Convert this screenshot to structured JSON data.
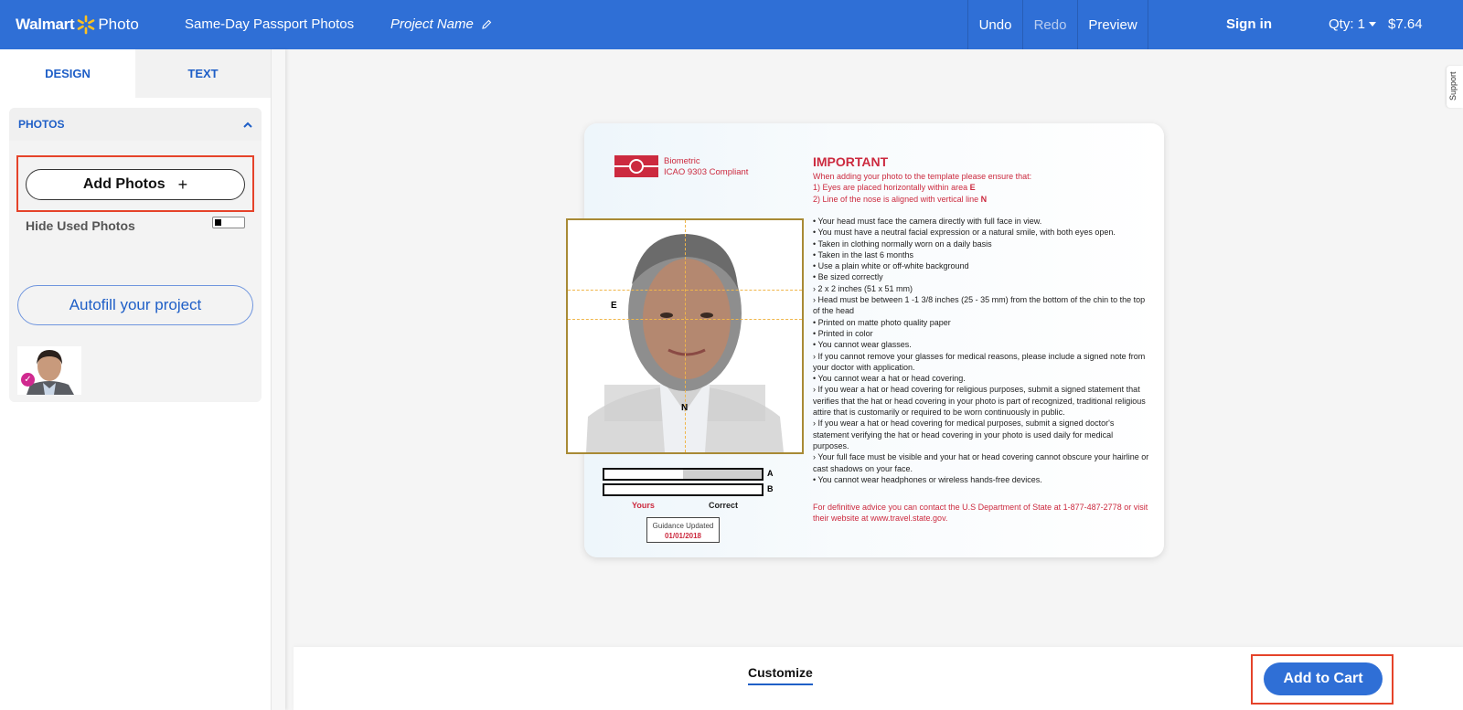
{
  "header": {
    "logo_brand": "Walmart",
    "logo_product": "Photo",
    "title": "Same-Day Passport Photos",
    "project_name": "Project Name",
    "undo": "Undo",
    "redo": "Redo",
    "preview": "Preview",
    "sign_in": "Sign in",
    "qty": "Qty: 1",
    "price": "$7.64"
  },
  "sidebar": {
    "tabs": [
      {
        "label": "DESIGN",
        "active": true
      },
      {
        "label": "TEXT",
        "active": false
      }
    ],
    "section_title": "PHOTOS",
    "add_photos": "Add Photos",
    "add_icon": "+",
    "hide_used": "Hide Used Photos",
    "autofill": "Autofill your project"
  },
  "template": {
    "biometric": "Biometric",
    "icao": "ICAO 9303 Compliant",
    "important_title": "IMPORTANT",
    "intro": "When adding your photo to the template please ensure that:",
    "step1": "1) Eyes are placed horizontally within area ",
    "step1_key": "E",
    "step2": "2) Line of the nose is aligned with vertical line ",
    "step2_key": "N",
    "rules": [
      "• Your head must face the camera directly with full face in view.",
      "• You must have a neutral facial expression or a natural smile, with both eyes open.",
      "• Taken in clothing normally worn on a daily basis",
      "• Taken in the last 6 months",
      "• Use a plain white or off-white background",
      "• Be sized correctly",
      "› 2 x 2 inches (51 x 51 mm)",
      "› Head must be between 1 -1 3/8 inches (25 - 35 mm) from the bottom of the chin to the top of the head",
      "• Printed on matte photo quality paper",
      "• Printed in color",
      "• You cannot wear glasses.",
      "› If you cannot remove your glasses for medical reasons, please include a signed note from your doctor with application.",
      "• You cannot wear a hat or head covering.",
      "› If you wear a hat or head covering for religious purposes, submit a signed statement that verifies that the hat or head covering in your photo is part of recognized, traditional religious attire that is customarily or required to be worn continuously in public.",
      "› If you wear a hat or head covering for medical purposes, submit a signed doctor's statement verifying the hat or head covering in your photo is used daily for medical purposes.",
      "› Your full face must be visible and your hat or head covering cannot obscure your hairline or cast shadows on your face.",
      "• You cannot wear headphones or wireless hands-free devices."
    ],
    "advice": "For definitive advice you can contact the U.S Department of State at 1-877-487-2778 or visit their website at www.travel.state.gov.",
    "label_e": "E",
    "label_n": "N",
    "bar_a": "A",
    "bar_b": "B",
    "yours": "Yours",
    "correct": "Correct",
    "guidance_label": "Guidance Updated",
    "guidance_date": "01/01/2018"
  },
  "support": "Support",
  "bottom": {
    "customize": "Customize",
    "add_to_cart": "Add to Cart"
  },
  "colors": {
    "brand_blue": "#2f6fd6",
    "accent_red": "#cc2a3f",
    "highlight": "#e5432a",
    "spark": "#ffc220"
  }
}
